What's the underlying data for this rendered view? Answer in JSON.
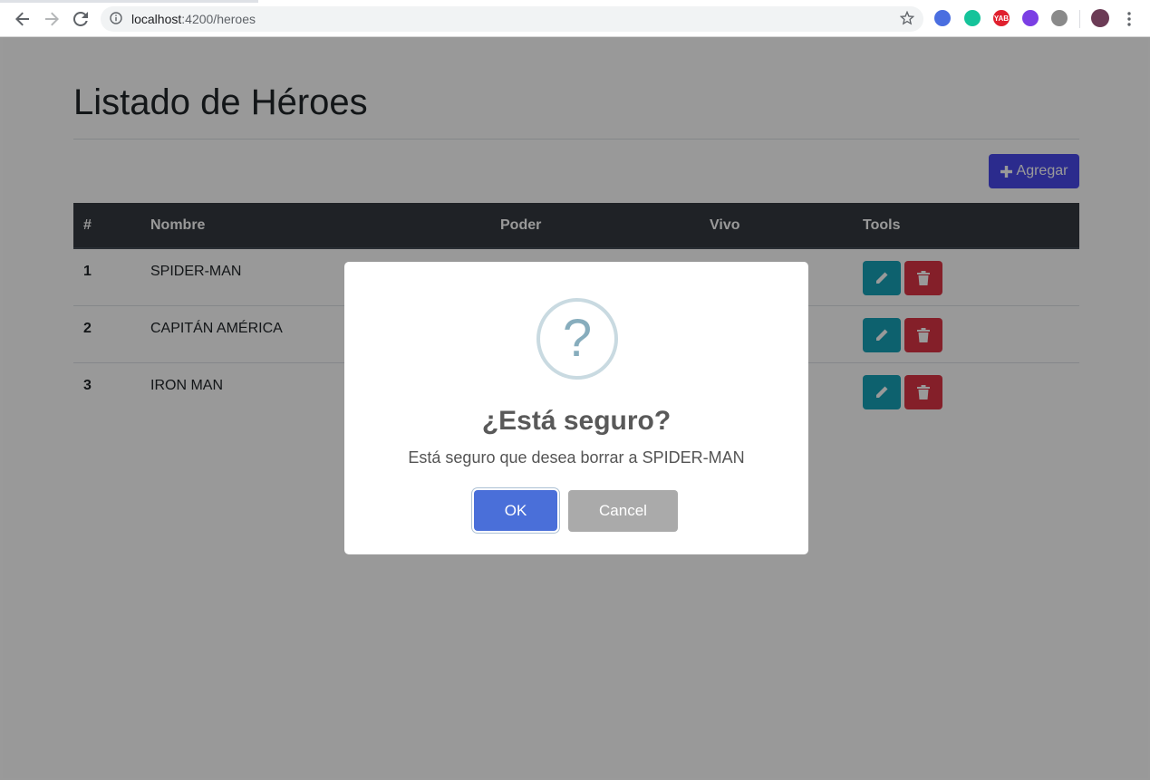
{
  "browser": {
    "url_host": "localhost",
    "url_path": ":4200/heroes",
    "extensions": [
      {
        "name": "translate-icon",
        "color": "#4a6ee0",
        "label": ""
      },
      {
        "name": "grammarly-icon",
        "color": "#15c39a",
        "label": ""
      },
      {
        "name": "yab-icon",
        "color": "#e0202e",
        "label": "YAB"
      },
      {
        "name": "check-extension-icon",
        "color": "#7b3fe4",
        "label": ""
      },
      {
        "name": "link-extension-icon",
        "color": "#8a8a8a",
        "label": ""
      }
    ]
  },
  "page": {
    "title": "Listado de Héroes",
    "add_button": "Agregar"
  },
  "table": {
    "headers": [
      "#",
      "Nombre",
      "Poder",
      "Vivo",
      "Tools"
    ],
    "rows": [
      {
        "num": "1",
        "name": "SPIDER-MAN"
      },
      {
        "num": "2",
        "name": "CAPITÁN AMÉRICA"
      },
      {
        "num": "3",
        "name": "IRON MAN"
      }
    ]
  },
  "dialog": {
    "icon": "?",
    "title": "¿Está seguro?",
    "text": "Está seguro que desea borrar a SPIDER-MAN",
    "ok_label": "OK",
    "cancel_label": "Cancel"
  },
  "colors": {
    "add_button": "#4949ec",
    "edit_button": "#17a2b8",
    "delete_button": "#dc3545",
    "ok_button": "#4a6fd9",
    "cancel_button": "#aaaaaa",
    "table_header": "#343a40"
  }
}
